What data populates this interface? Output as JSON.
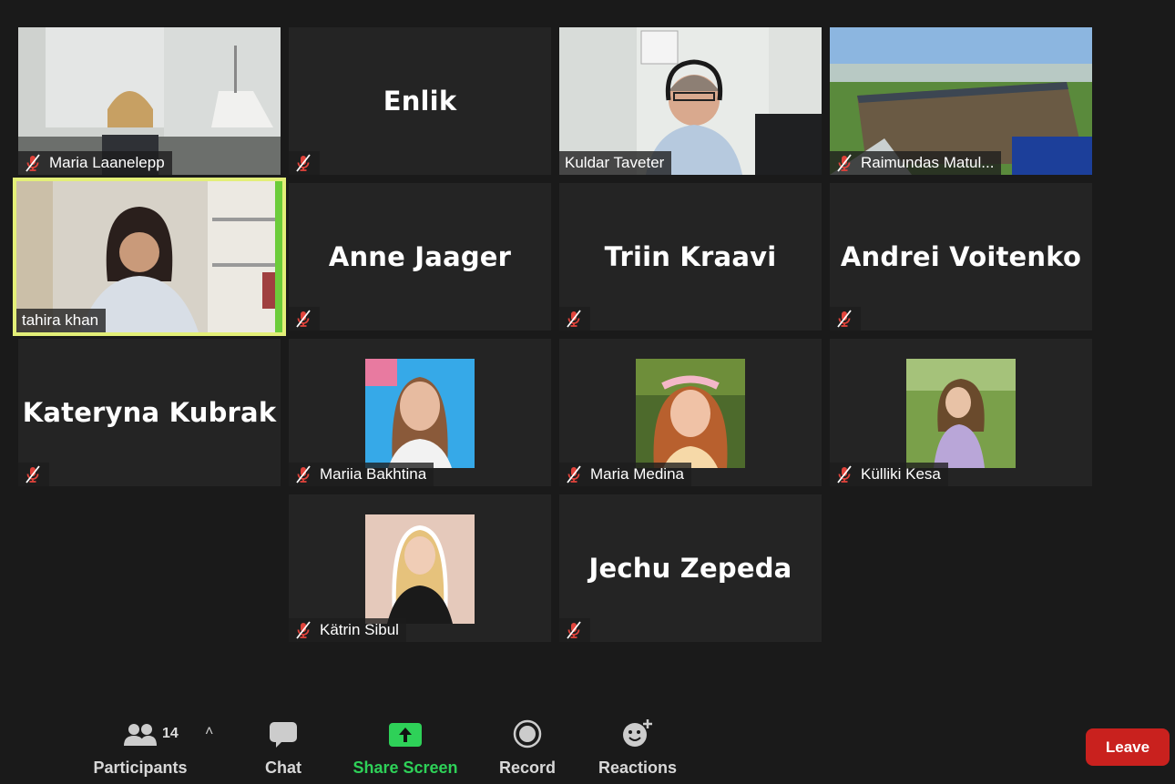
{
  "participants": [
    {
      "name": "Maria Laanelepp"
    },
    {
      "name": "Enlik"
    },
    {
      "name": "Kuldar Taveter"
    },
    {
      "name": "Raimundas Matul..."
    },
    {
      "name": "tahira khan"
    },
    {
      "name": "Anne Jaager"
    },
    {
      "name": "Triin Kraavi"
    },
    {
      "name": "Andrei Voitenko"
    },
    {
      "name": "Kateryna Kubrak"
    },
    {
      "name": "Mariia Bakhtina"
    },
    {
      "name": "Maria Medina"
    },
    {
      "name": "Külliki Kesa"
    },
    {
      "name": "Kätrin Sibul"
    },
    {
      "name": "Jechu Zepeda"
    }
  ],
  "toolbar": {
    "participants_label": "Participants",
    "participants_count": "14",
    "chat_label": "Chat",
    "share_label": "Share Screen",
    "record_label": "Record",
    "reactions_label": "Reactions",
    "leave_label": "Leave"
  },
  "colors": {
    "active_speaker_border": "#e3ef78",
    "share_green": "#2ed158",
    "leave_red": "#c9211e",
    "muted_red": "#e0433b"
  },
  "icons": {
    "muted": "mic-muted-icon",
    "participants": "participants-icon",
    "chat": "chat-icon",
    "share": "share-screen-icon",
    "record": "record-icon",
    "reactions": "reactions-icon"
  }
}
